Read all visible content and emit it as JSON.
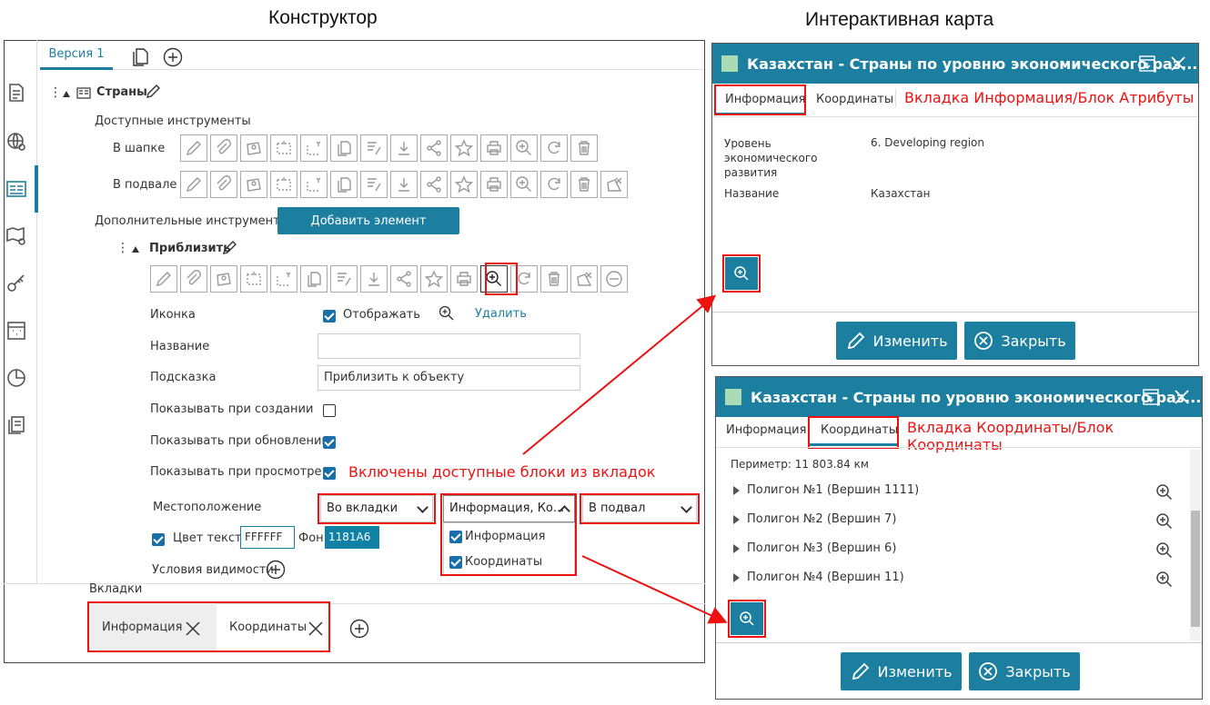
{
  "headings": {
    "constructor": "Конструктор",
    "map": "Интерактивная карта"
  },
  "constructor": {
    "version_tab": "Версия 1",
    "layer_name": "Страны",
    "available_tools": "Доступные инструменты",
    "in_header": "В шапке",
    "in_footer": "В подвале",
    "extra_tools": "Дополнительные инструменты",
    "add_element": "Добавить элемент",
    "zoom_tool": "Приблизить",
    "icon_label": "Иконка",
    "display_label": "Отображать",
    "delete_link": "Удалить",
    "name_label": "Название",
    "name_value": "",
    "hint_label": "Подсказка",
    "hint_value": "Приблизить к объекту",
    "show_create": "Показывать при создании",
    "show_update": "Показывать при обновлении",
    "show_view": "Показывать при просмотре",
    "location_label": "Местоположение",
    "location_value": "Во вкладки",
    "blocks_value": "Информация, Ко...",
    "footer_value": "В подвал",
    "opt_info": "Информация",
    "opt_coords": "Координаты",
    "text_color_label": "Цвет текста",
    "text_color_value": "FFFFFF",
    "bg_label": "Фон",
    "bg_value": "1181A6",
    "visibility": "Условия видимости",
    "tabs_label": "Вкладки",
    "tab_info": "Информация",
    "tab_coords": "Координаты",
    "annotation": "Включены доступные блоки из вкладок"
  },
  "map_top": {
    "title": "Казахстан - Страны по уровню экономического раз...",
    "tab_info": "Информация",
    "tab_coords": "Координаты",
    "annotation": "Вкладка Информация/Блок Атрибуты",
    "attrs": [
      {
        "key": "Уровень экономического развития",
        "value": "6. Developing region"
      },
      {
        "key": "Название",
        "value": "Казахстан"
      }
    ],
    "edit": "Изменить",
    "close": "Закрыть"
  },
  "map_bottom": {
    "title": "Казахстан - Страны по уровню экономического раз...",
    "tab_info": "Информация",
    "tab_coords": "Координаты",
    "annotation": "Вкладка Координаты/Блок Координаты",
    "perimeter": "Периметр: 11 803.84 км",
    "polygons": [
      "Полигон №1 (Вершин 1111)",
      "Полигон №2 (Вершин 7)",
      "Полигон №3 (Вершин 6)",
      "Полигон №4 (Вершин 11)"
    ],
    "edit": "Изменить",
    "close": "Закрыть"
  },
  "colors": {
    "accent": "#1D7FA0",
    "annotation": "#E11111"
  }
}
